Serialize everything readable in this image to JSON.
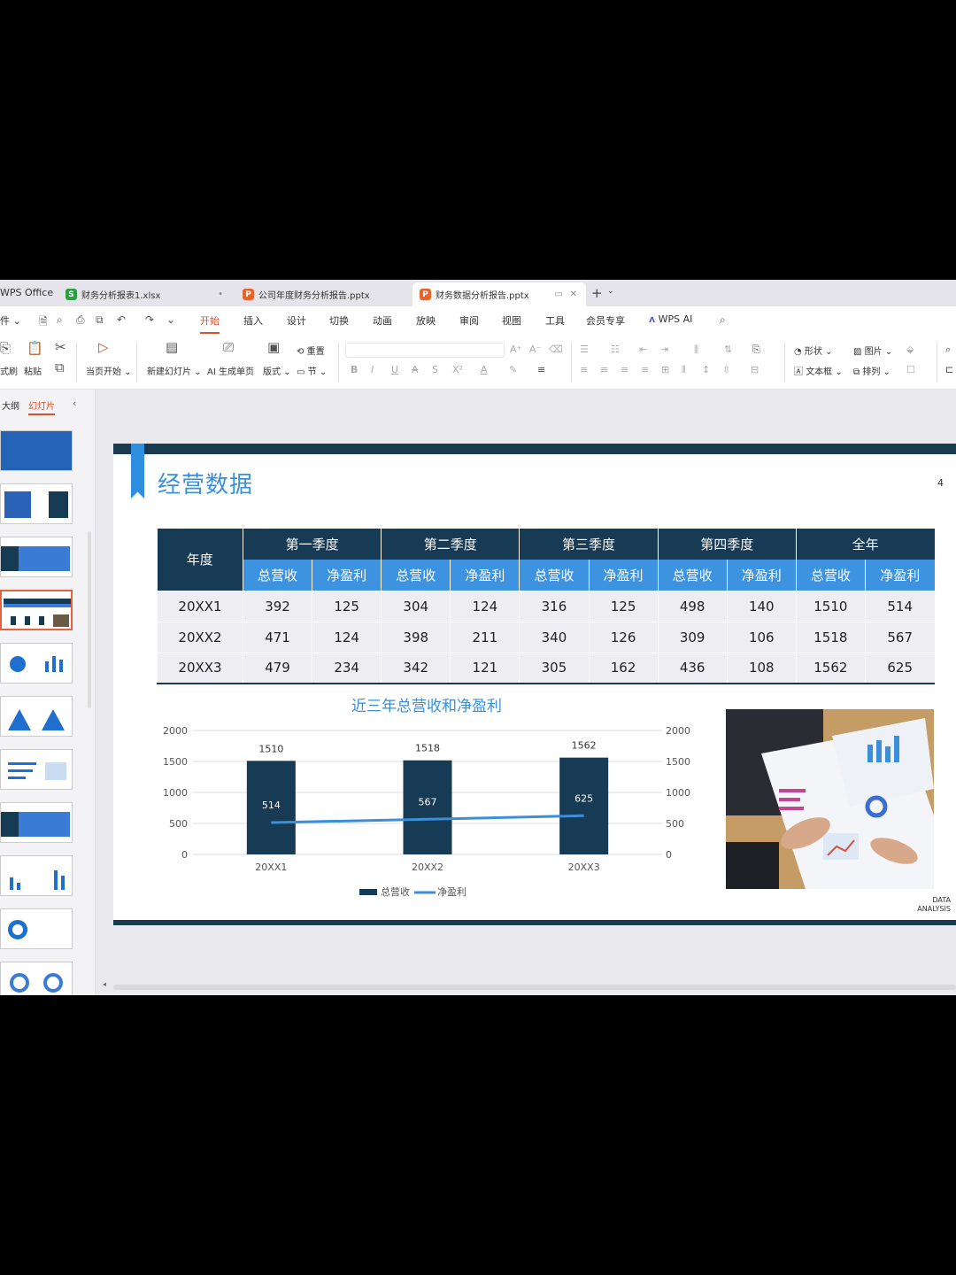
{
  "tabs": {
    "brand": "WPS Office",
    "items": [
      {
        "label": "财务分析报表1.xlsx",
        "icon": "S",
        "color": "#2ea043"
      },
      {
        "label": "公司年度财务分析报告.pptx",
        "icon": "P",
        "color": "#e8622c"
      },
      {
        "label": "财务数据分析报告.pptx",
        "icon": "P",
        "color": "#e8622c"
      }
    ],
    "new_tab": "+"
  },
  "menu": {
    "file": "件",
    "items": [
      "开始",
      "插入",
      "设计",
      "切换",
      "动画",
      "放映",
      "审阅",
      "视图",
      "工具",
      "会员专享"
    ],
    "ai": "WPS AI"
  },
  "ribbon": {
    "format_painter": "式刷",
    "paste": "粘贴",
    "play_from_current": "当页开始",
    "new_slide": "新建幻灯片",
    "ai_single_page": "AI 生成单页",
    "layout": "版式",
    "reset": "重置",
    "section": "节",
    "shape": "形状",
    "picture": "图片",
    "textbox": "文本框",
    "arrange": "排列"
  },
  "panel": {
    "outline": "大纲",
    "slides": "幻灯片"
  },
  "slide": {
    "title": "经营数据",
    "page_number": "4",
    "table": {
      "year_header": "年度",
      "groups": [
        "第一季度",
        "第二季度",
        "第三季度",
        "第四季度",
        "全年"
      ],
      "sub_headers": [
        "总营收",
        "净盈利"
      ],
      "rows": [
        {
          "year": "20XX1",
          "values": [
            "392",
            "125",
            "304",
            "124",
            "316",
            "125",
            "498",
            "140",
            "1510",
            "514"
          ]
        },
        {
          "year": "20XX2",
          "values": [
            "471",
            "124",
            "398",
            "211",
            "340",
            "126",
            "309",
            "106",
            "1518",
            "567"
          ]
        },
        {
          "year": "20XX3",
          "values": [
            "479",
            "234",
            "342",
            "121",
            "305",
            "162",
            "436",
            "108",
            "1562",
            "625"
          ]
        }
      ]
    },
    "data_analysis": [
      "DATA",
      "ANALYSIS"
    ]
  },
  "chart_data": {
    "type": "bar",
    "title": "近三年总营收和净盈利",
    "categories": [
      "20XX1",
      "20XX2",
      "20XX3"
    ],
    "series": [
      {
        "name": "总营收",
        "type": "bar",
        "values": [
          1510,
          1518,
          1562
        ],
        "color": "#173a55"
      },
      {
        "name": "净盈利",
        "type": "line",
        "values": [
          514,
          567,
          625
        ],
        "color": "#3a8fd8"
      }
    ],
    "ylim": [
      0,
      2000
    ],
    "yticks": [
      0,
      500,
      1000,
      1500,
      2000
    ],
    "secondary_yticks": [
      0,
      500,
      1000,
      1500,
      2000
    ],
    "grid": true,
    "legend": "bottom"
  },
  "colors": {
    "navy": "#173a55",
    "blue": "#3d93e0",
    "accent": "#d9502a"
  }
}
